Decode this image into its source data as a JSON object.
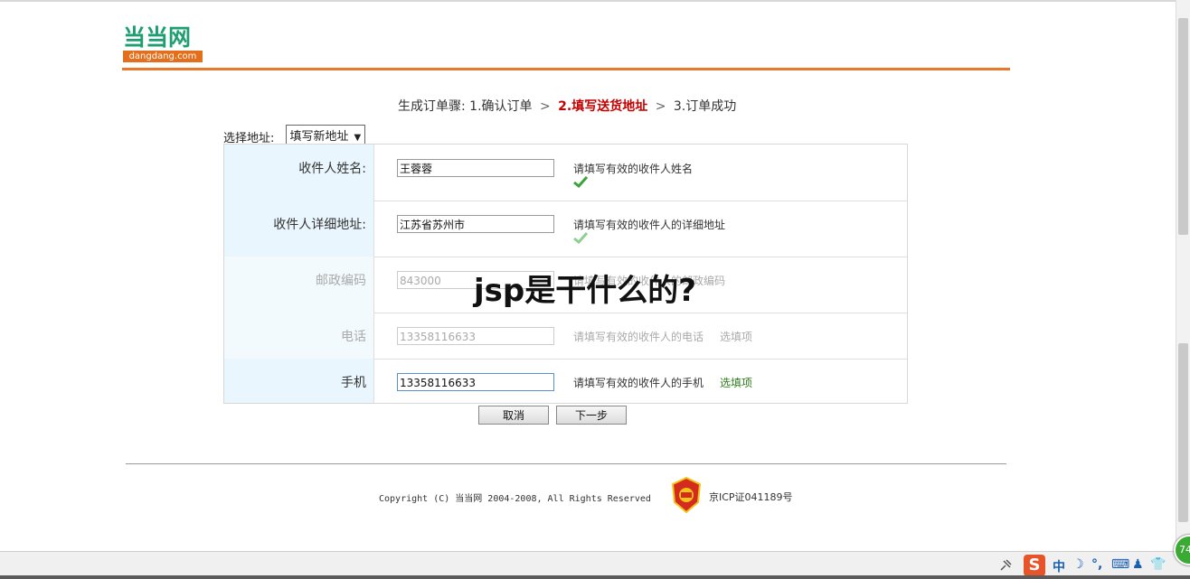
{
  "logo": {
    "cn": "当当网",
    "en": "dangdang.com"
  },
  "steps": {
    "prefix": "生成订单骤:",
    "step1": "1.确认订单",
    "arrow": ">",
    "step2": "2.填写送货地址",
    "step3": "3.订单成功"
  },
  "address_select": {
    "label": "选择地址:",
    "value": "填写新地址"
  },
  "form": {
    "rows": [
      {
        "label": "收件人姓名:",
        "value": "王蓉蓉",
        "hint": "请填写有效的收件人姓名",
        "optional": "",
        "valid": true
      },
      {
        "label": "收件人详细地址:",
        "value": "江苏省苏州市",
        "hint": "请填写有效的收件人的详细地址",
        "optional": "",
        "valid": true
      },
      {
        "label": "邮政编码",
        "value": "843000",
        "hint": "请填写有效的收件人的邮政编码",
        "optional": "",
        "valid": true
      },
      {
        "label": "电话",
        "value": "13358116633",
        "hint": "请填写有效的收件人的电话",
        "optional": "选填项",
        "valid": false
      },
      {
        "label": "手机",
        "value": "13358116633",
        "hint": "请填写有效的收件人的手机",
        "optional": "选填项",
        "valid": false
      }
    ]
  },
  "overlay_title": "jsp是干什么的?",
  "buttons": {
    "cancel": "取消",
    "next": "下一步"
  },
  "footer": {
    "copyright": "Copyright (C) 当当网 2004-2008, All Rights Reserved",
    "icp": "京ICP证041189号"
  },
  "taskbar": {
    "ime_logo": "S",
    "ime_lang": "中",
    "tray_badge": "74"
  },
  "colors": {
    "brand_green": "#1f9e72",
    "brand_orange": "#e8782a",
    "current_step": "#c40000",
    "label_bg": "#eaf6fd",
    "optional_green": "#2e7d1a"
  }
}
